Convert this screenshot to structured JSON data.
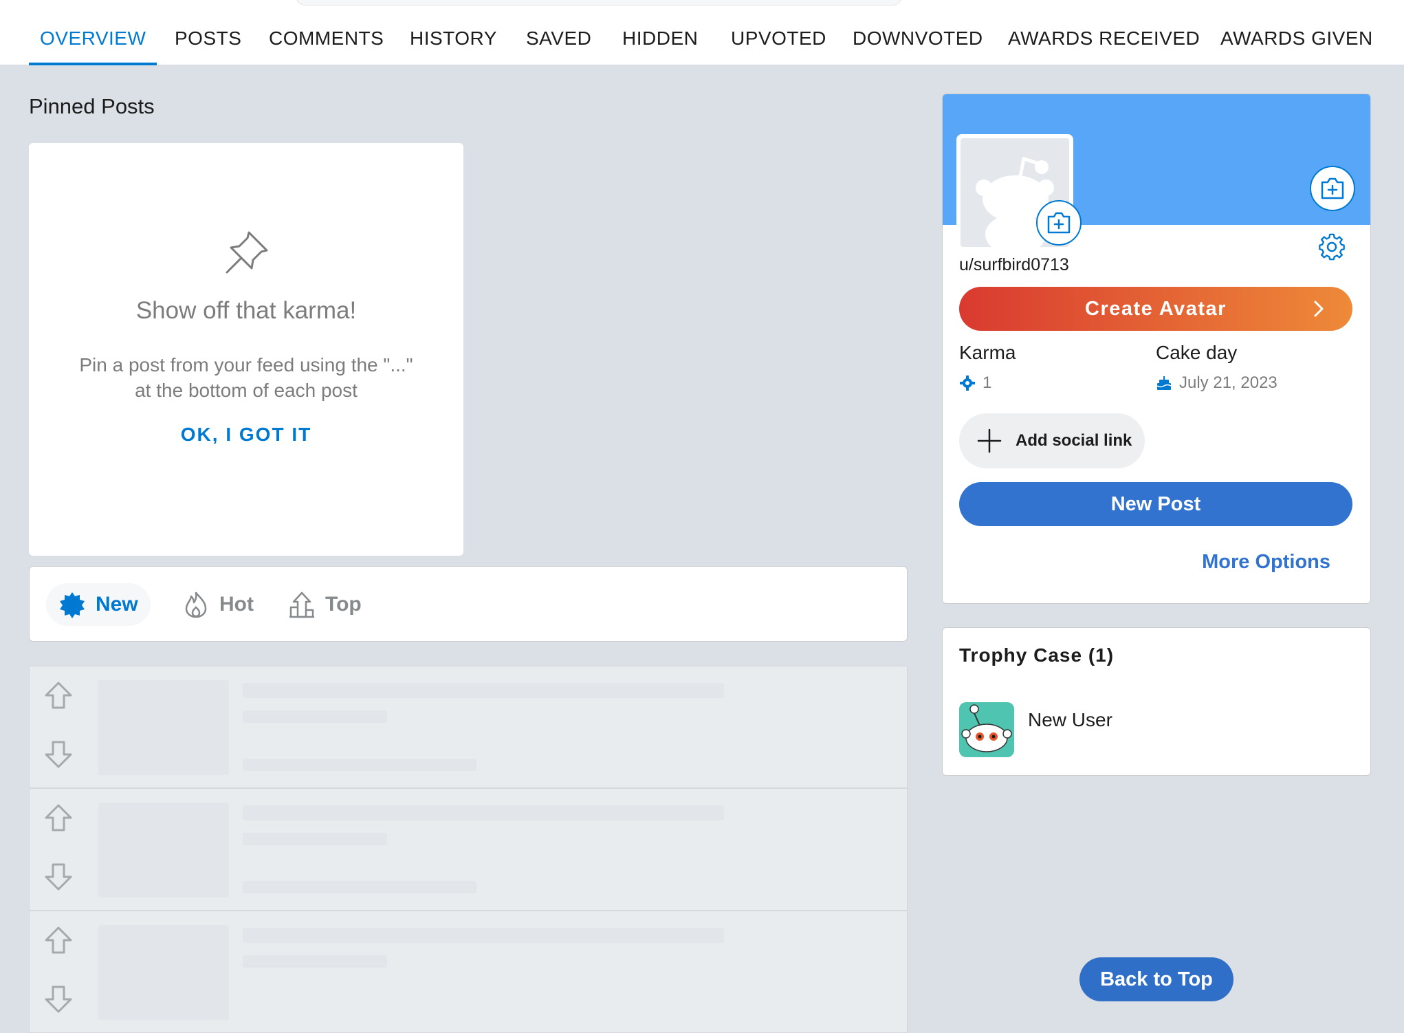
{
  "tabs": [
    {
      "label": "OVERVIEW",
      "active": true
    },
    {
      "label": "POSTS",
      "active": false
    },
    {
      "label": "COMMENTS",
      "active": false
    },
    {
      "label": "HISTORY",
      "active": false
    },
    {
      "label": "SAVED",
      "active": false
    },
    {
      "label": "HIDDEN",
      "active": false
    },
    {
      "label": "UPVOTED",
      "active": false
    },
    {
      "label": "DOWNVOTED",
      "active": false
    },
    {
      "label": "AWARDS RECEIVED",
      "active": false
    },
    {
      "label": "AWARDS GIVEN",
      "active": false
    }
  ],
  "pinned": {
    "heading": "Pinned Posts",
    "title": "Show off that karma!",
    "description": "Pin a post from your feed using the \"...\" at the bottom of each post",
    "button": "OK, I GOT IT"
  },
  "sort": {
    "options": [
      {
        "label": "New",
        "icon": "new-burst-icon",
        "active": true
      },
      {
        "label": "Hot",
        "icon": "flame-icon",
        "active": false
      },
      {
        "label": "Top",
        "icon": "top-chart-icon",
        "active": false
      }
    ]
  },
  "profile": {
    "username": "u/surfbird0713",
    "create_avatar": "Create Avatar",
    "karma_label": "Karma",
    "karma_value": "1",
    "cakeday_label": "Cake day",
    "cakeday_value": "July 21, 2023",
    "social_link": "Add social link",
    "new_post": "New Post",
    "more_options": "More Options"
  },
  "trophy": {
    "title": "Trophy Case (1)",
    "items": [
      {
        "name": "New User",
        "icon": "new-user-snoo-icon"
      }
    ]
  },
  "back_to_top": "Back to Top",
  "colors": {
    "accent": "#0079d3",
    "banner": "#58a6f8",
    "button_blue": "#3273cf",
    "gradient_start": "#d93a30",
    "gradient_end": "#ee8a38",
    "background": "#dae0e6"
  }
}
